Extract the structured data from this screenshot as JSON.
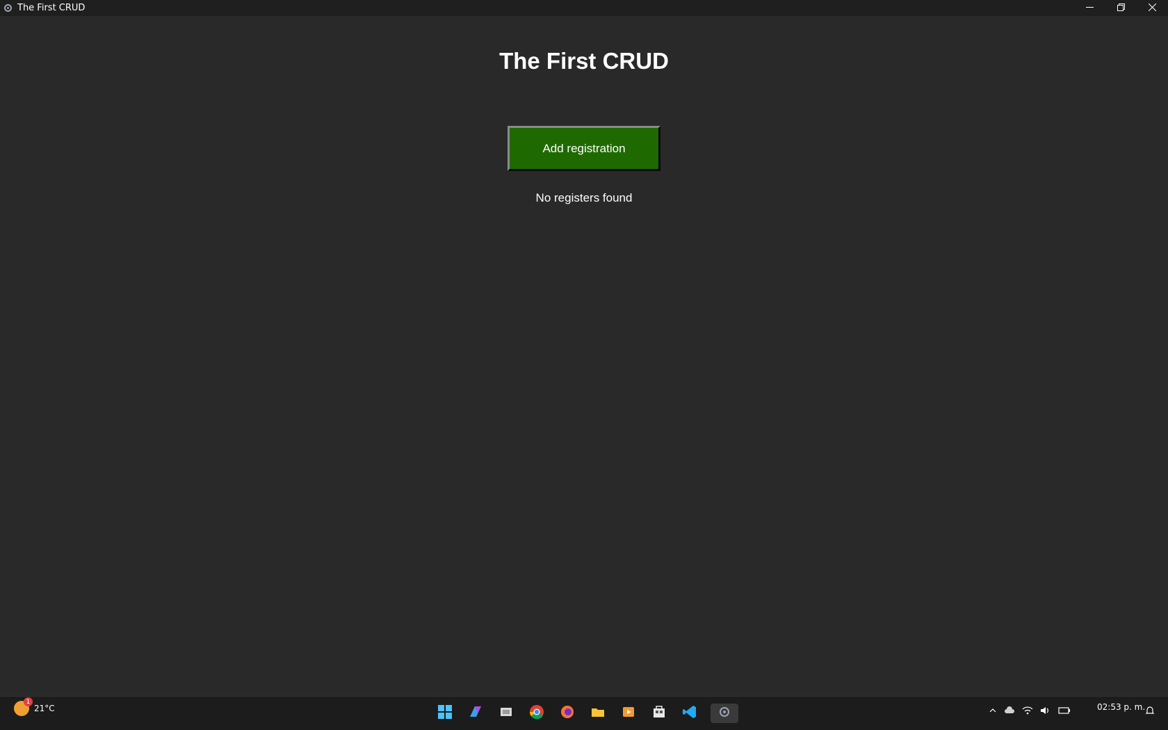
{
  "window": {
    "title": "The First CRUD",
    "app_icon": "gear-icon",
    "controls": [
      "minimize-icon",
      "restore-icon",
      "close-icon"
    ]
  },
  "main": {
    "heading": "The First CRUD",
    "add_button_label": "Add registration",
    "empty_message": "No registers found",
    "colors": {
      "background": "#292929",
      "button": "#1e6a00",
      "text": "#ffffff"
    }
  },
  "taskbar": {
    "weather": {
      "temperature": "21°C",
      "badge": "1"
    },
    "apps": [
      "start-icon",
      "copilot-icon",
      "task-view-icon",
      "chrome-icon",
      "firefox-icon",
      "file-explorer-icon",
      "media-icon",
      "store-icon",
      "vscode-icon",
      "python-app-icon"
    ],
    "tray_icons": [
      "chevron-up-icon",
      "cloud-icon",
      "wifi-icon",
      "volume-icon",
      "battery-icon"
    ],
    "clock": "02:53 p. m."
  }
}
